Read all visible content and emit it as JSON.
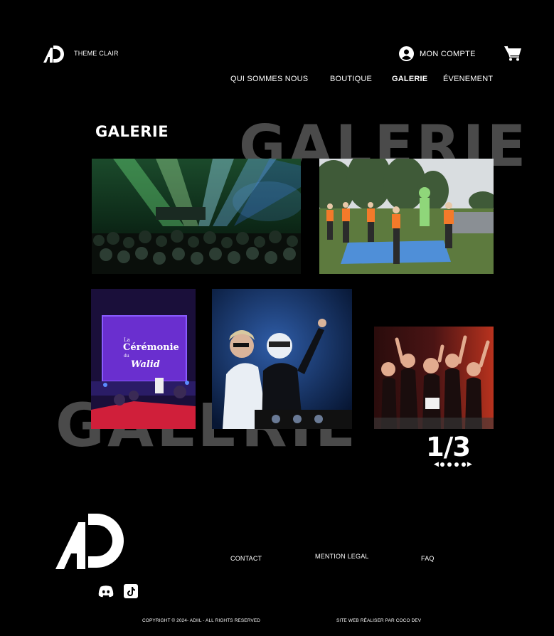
{
  "header": {
    "theme_toggle_label": "THEME CLAIR",
    "account_label": "MON COMPTE"
  },
  "nav": {
    "items": [
      {
        "label": "QUI SOMMES NOUS",
        "active": false
      },
      {
        "label": "BOUTIQUE",
        "active": false
      },
      {
        "label": "GALERIE",
        "active": true
      },
      {
        "label": "ÉVENEMENT",
        "active": false
      }
    ]
  },
  "gallery": {
    "title": "GALERIE",
    "background_word_top": "GALERIE",
    "background_word_bottom": "GALERIE",
    "photos": [
      {
        "name": "concert-stage-lights"
      },
      {
        "name": "outdoor-orange-tshirts-group"
      },
      {
        "name": "ceremony-screen"
      },
      {
        "name": "dj-performers"
      },
      {
        "name": "cheering-crowd"
      }
    ],
    "screen_text_line1": "La",
    "screen_text_line2": "Cérémonie",
    "screen_text_line3": "du",
    "screen_text_line4": "Walid",
    "pager": {
      "count": "1/3",
      "dots": 4
    }
  },
  "footer": {
    "links": {
      "contact": "CONTACT",
      "mention": "MENTION LEGAL",
      "faq": "FAQ"
    },
    "copyright": "COPYRIGHT © 2024- ADIIL - ALL RIGHTS RESERVED",
    "credit": "SITE WEB RÉALISER PAR COCO DEV"
  },
  "colors": {
    "background": "#000000",
    "text": "#ffffff",
    "background_word": "#4a4a4a"
  },
  "icons": [
    "ad-logo-icon",
    "account-icon",
    "cart-icon",
    "discord-icon",
    "tiktok-icon",
    "chevron-left-icon",
    "chevron-right-icon"
  ]
}
